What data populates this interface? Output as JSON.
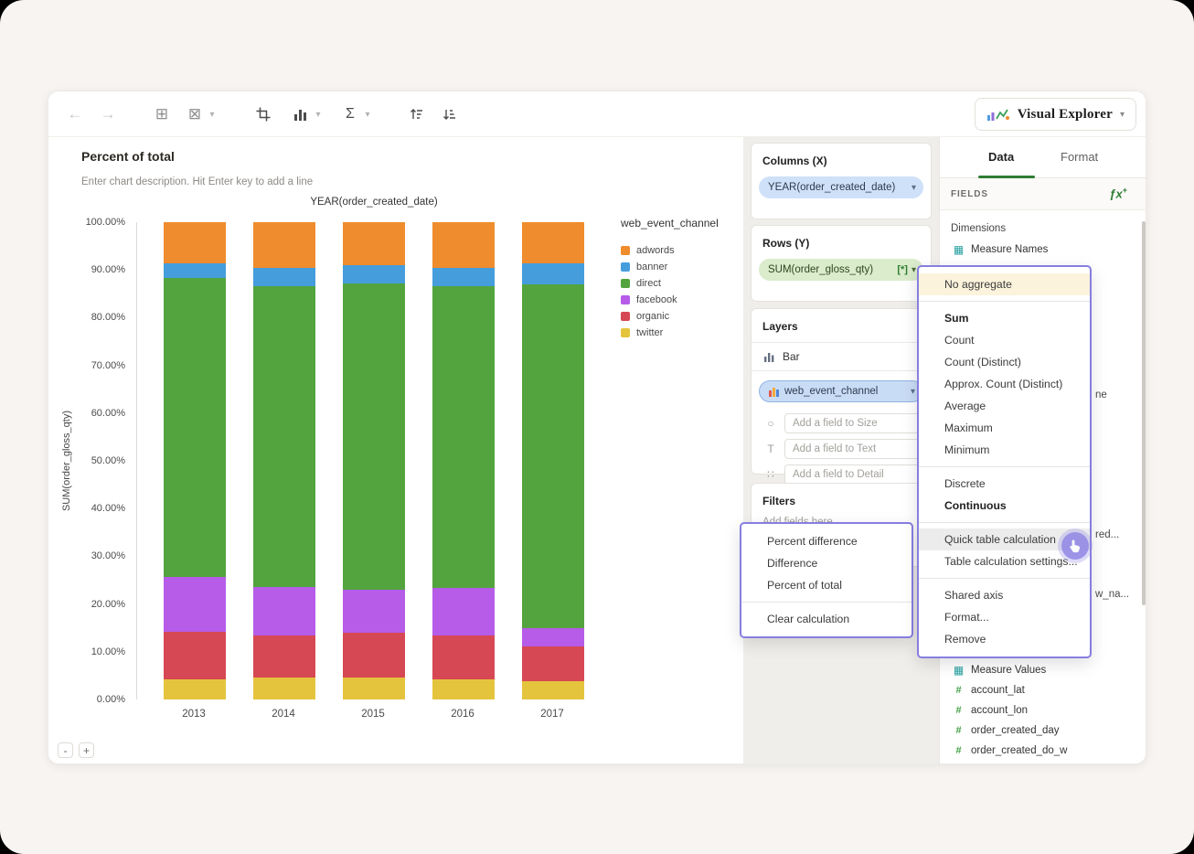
{
  "icons": {
    "back": "←",
    "forward": "→",
    "copy_chart": "⊞",
    "delete_chart": "⊠",
    "sigma": "Σ",
    "caret": "▾",
    "size_icon": "○",
    "text_icon": "T",
    "detail_icon": "∷",
    "measure_glyph": "▦",
    "number_glyph": "#"
  },
  "toolbar": {
    "brand_label": "Visual Explorer"
  },
  "chart_header": {
    "title": "Percent of total",
    "description": "Enter chart description. Hit Enter key to add a line"
  },
  "chart_data": {
    "type": "bar",
    "stacked": true,
    "percent_of_total": true,
    "title": "YEAR(order_created_date)",
    "xlabel": "",
    "ylabel": "SUM(order_gloss_qty)",
    "ylim": [
      0,
      100
    ],
    "yticks": [
      "0.00%",
      "10.00%",
      "20.00%",
      "30.00%",
      "40.00%",
      "50.00%",
      "60.00%",
      "70.00%",
      "80.00%",
      "90.00%",
      "100.00%"
    ],
    "categories": [
      "2013",
      "2014",
      "2015",
      "2016",
      "2017"
    ],
    "series": [
      {
        "name": "twitter",
        "color": "#e5c43d",
        "values": [
          4.2,
          4.6,
          4.6,
          4.2,
          3.8
        ]
      },
      {
        "name": "organic",
        "color": "#d64853",
        "values": [
          10.0,
          8.8,
          9.4,
          9.2,
          7.3
        ]
      },
      {
        "name": "facebook",
        "color": "#b65ce8",
        "values": [
          11.4,
          10.2,
          9.0,
          10.0,
          3.8
        ]
      },
      {
        "name": "direct",
        "color": "#53a43e",
        "values": [
          62.7,
          63.0,
          64.2,
          63.2,
          72.1
        ]
      },
      {
        "name": "banner",
        "color": "#459ddc",
        "values": [
          3.1,
          3.8,
          3.8,
          3.8,
          4.4
        ]
      },
      {
        "name": "adwords",
        "color": "#ef8c2d",
        "values": [
          8.6,
          9.6,
          9.0,
          9.6,
          8.6
        ]
      }
    ],
    "legend_title": "web_event_channel",
    "legend_order": [
      "adwords",
      "banner",
      "direct",
      "facebook",
      "organic",
      "twitter"
    ],
    "legend_position": "right",
    "grid": false
  },
  "shelves": {
    "columns": {
      "title": "Columns (X)",
      "pill": "YEAR(order_created_date)"
    },
    "rows": {
      "title": "Rows (Y)",
      "pill": "SUM(order_gloss_qty)",
      "pill_suffix": "[*]"
    },
    "layers": {
      "title": "Layers",
      "type_label": "Bar",
      "color_pill": "web_event_channel",
      "placeholders": [
        "Add a field to Size",
        "Add a field to Text",
        "Add a field to Detail"
      ]
    },
    "filters": {
      "title": "Filters",
      "placeholder": "Add fields here..."
    }
  },
  "agg_menu": {
    "items": [
      {
        "label": "No aggregate",
        "style": "cream",
        "divider_after": true
      },
      {
        "label": "Sum",
        "bold": true
      },
      {
        "label": "Count"
      },
      {
        "label": "Count (Distinct)"
      },
      {
        "label": "Approx. Count (Distinct)"
      },
      {
        "label": "Average"
      },
      {
        "label": "Maximum"
      },
      {
        "label": "Minimum",
        "divider_after": true
      },
      {
        "label": "Discrete"
      },
      {
        "label": "Continuous",
        "bold": true,
        "divider_after": true
      },
      {
        "label": "Quick table calculation",
        "highlighted": true
      },
      {
        "label": "Table calculation settings...",
        "divider_after": true
      },
      {
        "label": "Shared axis"
      },
      {
        "label": "Format..."
      },
      {
        "label": "Remove"
      }
    ]
  },
  "calc_menu": {
    "items": [
      {
        "label": "Percent difference"
      },
      {
        "label": "Difference"
      },
      {
        "label": "Percent of total",
        "divider_after": true
      },
      {
        "label": "Clear calculation"
      }
    ]
  },
  "data_panel": {
    "tabs": [
      "Data",
      "Format"
    ],
    "active_tab": "Data",
    "fields_header": "FIELDS",
    "fx_label": "ƒx",
    "dimensions_label": "Dimensions",
    "dimension_items": [
      "Measure Names"
    ],
    "hidden_fragments": [
      "ne",
      "red...",
      "w_na..."
    ],
    "measure_items": [
      {
        "icon": "measure-values",
        "label": "Measure Values"
      },
      {
        "icon": "number",
        "label": "account_lat"
      },
      {
        "icon": "number",
        "label": "account_lon"
      },
      {
        "icon": "number",
        "label": "order_created_day"
      },
      {
        "icon": "number",
        "label": "order_created_do_w"
      }
    ]
  },
  "zoom_controls": {
    "minus": "-",
    "plus": "+"
  }
}
